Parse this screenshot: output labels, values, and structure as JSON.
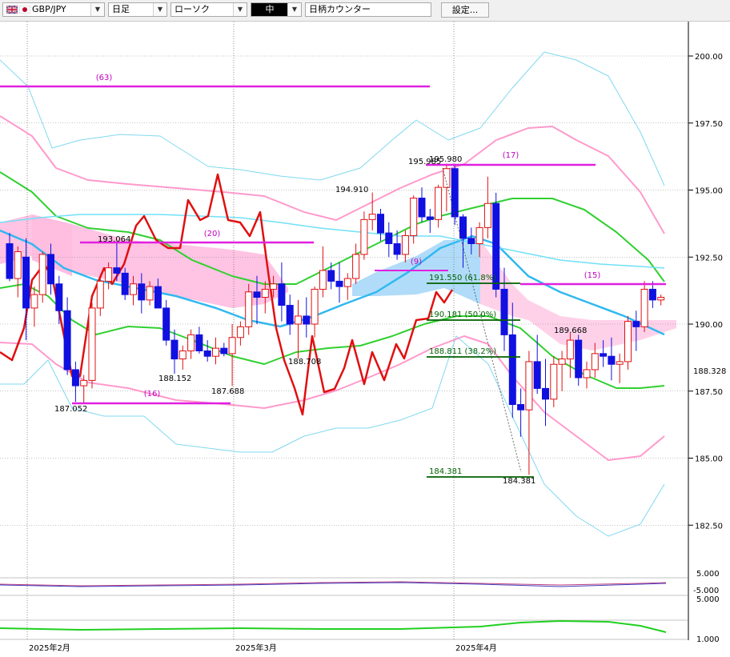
{
  "toolbar": {
    "symbol": "GBP/JPY",
    "timeframe": "日足",
    "chart_style": "ローソク",
    "size": "中",
    "counter_placeholder": "日柄カウンター",
    "settings_label": "設定..."
  },
  "colors": {
    "candle_up_border": "#e01010",
    "candle_down": "#1010e0",
    "tenkan": "#e01010",
    "kumo_bull": "#ffbde0",
    "kumo_bear": "#a8d8f8",
    "ma_short": "#30d030",
    "ma_mid": "#30b8f0",
    "ma_long": "#70e0f8",
    "bb2": "#ff99cc",
    "bb3": "#80d8f0",
    "fib_line": "#006000",
    "count_line": "#e020e0",
    "count_text": "#c000c0"
  },
  "axis": {
    "price_ticks": [
      "200.00",
      "197.50",
      "195.00",
      "192.50",
      "190.00",
      "187.50",
      "185.00",
      "182.50"
    ],
    "current_price": "188.328",
    "osc1_ticks": [
      "5.000",
      "-5.000"
    ],
    "osc2_ticks": [
      "5.000",
      "1.000"
    ],
    "date_labels": [
      "2025年2月",
      "2025年3月",
      "2025年4月"
    ]
  },
  "annotations": {
    "counts": [
      "(63)",
      "(20)",
      "(16)",
      "(9)",
      "(17)",
      "(15)"
    ],
    "prices": [
      "193.064",
      "188.152",
      "187.688",
      "187.052",
      "194.910",
      "195.985",
      "195.980",
      "188.708",
      "189.668",
      "184.381"
    ],
    "fibs": [
      "191.550 (61.8%)",
      "190.181 (50.0%)",
      "188.811 (38.2%)",
      "184.381"
    ]
  },
  "chart_data": {
    "type": "candlestick",
    "ylim": [
      181,
      201.5
    ],
    "candles": [
      [
        193.0,
        193.4,
        191.6,
        191.7
      ],
      [
        191.7,
        192.9,
        191.0,
        192.7
      ],
      [
        192.5,
        193.2,
        189.4,
        190.6
      ],
      [
        190.6,
        191.4,
        189.9,
        191.1
      ],
      [
        191.1,
        192.7,
        190.8,
        192.6
      ],
      [
        192.6,
        193.0,
        191.1,
        191.5
      ],
      [
        191.5,
        191.8,
        190.0,
        190.5
      ],
      [
        190.5,
        191.0,
        188.1,
        188.3
      ],
      [
        188.3,
        188.6,
        187.1,
        187.7
      ],
      [
        187.7,
        188.1,
        187.05,
        187.9
      ],
      [
        187.9,
        190.8,
        187.6,
        190.6
      ],
      [
        190.6,
        191.8,
        190.3,
        191.6
      ],
      [
        191.6,
        192.3,
        191.3,
        192.1
      ],
      [
        192.1,
        193.064,
        191.6,
        191.9
      ],
      [
        191.9,
        192.1,
        190.9,
        191.1
      ],
      [
        191.1,
        191.8,
        190.7,
        191.5
      ],
      [
        191.5,
        191.9,
        190.4,
        190.9
      ],
      [
        190.9,
        191.6,
        190.7,
        191.4
      ],
      [
        191.4,
        191.7,
        190.6,
        190.6
      ],
      [
        190.6,
        190.9,
        189.2,
        189.4
      ],
      [
        189.4,
        189.8,
        188.152,
        188.7
      ],
      [
        188.7,
        189.2,
        188.3,
        189.0
      ],
      [
        189.0,
        189.8,
        188.7,
        189.6
      ],
      [
        189.6,
        189.9,
        188.9,
        189.0
      ],
      [
        189.0,
        189.4,
        188.6,
        188.8
      ],
      [
        188.8,
        189.5,
        188.5,
        189.1
      ],
      [
        189.1,
        189.3,
        188.8,
        188.9
      ],
      [
        188.9,
        190.0,
        187.688,
        189.5
      ],
      [
        189.5,
        190.1,
        189.2,
        189.9
      ],
      [
        189.9,
        191.5,
        189.6,
        191.2
      ],
      [
        191.2,
        191.8,
        190.0,
        191.0
      ],
      [
        191.0,
        191.6,
        190.4,
        191.3
      ],
      [
        191.3,
        191.8,
        191.0,
        191.5
      ],
      [
        191.5,
        192.3,
        190.1,
        190.7
      ],
      [
        190.7,
        191.1,
        189.6,
        190.0
      ],
      [
        190.0,
        190.9,
        188.708,
        190.3
      ],
      [
        190.3,
        191.0,
        189.5,
        190.0
      ],
      [
        190.0,
        191.4,
        189.5,
        191.3
      ],
      [
        191.3,
        192.9,
        191.0,
        192.0
      ],
      [
        192.0,
        192.3,
        191.3,
        191.6
      ],
      [
        191.6,
        192.3,
        190.8,
        191.4
      ],
      [
        191.4,
        191.9,
        190.9,
        191.7
      ],
      [
        191.7,
        193.0,
        191.5,
        192.6
      ],
      [
        192.6,
        194.2,
        192.4,
        193.9
      ],
      [
        193.9,
        194.91,
        193.5,
        194.1
      ],
      [
        194.1,
        194.3,
        193.1,
        193.4
      ],
      [
        193.4,
        193.8,
        192.5,
        193.0
      ],
      [
        193.0,
        193.5,
        192.4,
        192.6
      ],
      [
        192.6,
        193.5,
        192.3,
        193.3
      ],
      [
        193.3,
        194.8,
        193.0,
        194.7
      ],
      [
        194.7,
        195.1,
        193.8,
        194.0
      ],
      [
        194.0,
        194.3,
        193.4,
        193.9
      ],
      [
        193.9,
        195.2,
        193.6,
        195.1
      ],
      [
        195.1,
        195.985,
        194.2,
        195.8
      ],
      [
        195.8,
        195.98,
        193.7,
        194.0
      ],
      [
        194.0,
        194.1,
        192.1,
        193.2
      ],
      [
        193.2,
        193.6,
        192.6,
        193.0
      ],
      [
        193.0,
        193.8,
        192.5,
        193.6
      ],
      [
        193.6,
        195.5,
        193.2,
        194.5
      ],
      [
        194.5,
        194.9,
        191.0,
        191.3
      ],
      [
        191.3,
        192.1,
        189.0,
        189.6
      ],
      [
        189.6,
        190.8,
        186.5,
        187.0
      ],
      [
        187.0,
        187.6,
        185.8,
        186.8
      ],
      [
        186.8,
        189.0,
        184.381,
        188.6
      ],
      [
        188.6,
        189.6,
        187.4,
        187.6
      ],
      [
        187.6,
        188.7,
        186.2,
        187.2
      ],
      [
        187.2,
        188.8,
        186.9,
        188.5
      ],
      [
        188.5,
        189.0,
        187.5,
        188.7
      ],
      [
        188.7,
        189.668,
        188.0,
        189.4
      ],
      [
        189.4,
        189.6,
        187.7,
        188.0
      ],
      [
        188.0,
        188.6,
        187.6,
        188.3
      ],
      [
        188.3,
        189.3,
        188.0,
        188.9
      ],
      [
        188.9,
        189.4,
        188.4,
        188.8
      ],
      [
        188.8,
        189.5,
        187.9,
        188.5
      ],
      [
        188.5,
        188.9,
        187.8,
        188.6
      ],
      [
        188.6,
        190.3,
        188.3,
        190.1
      ],
      [
        190.1,
        190.5,
        189.0,
        189.9
      ],
      [
        189.9,
        191.6,
        189.7,
        191.3
      ],
      [
        191.3,
        191.6,
        190.6,
        190.9
      ],
      [
        190.9,
        191.1,
        190.7,
        191.0
      ]
    ]
  }
}
